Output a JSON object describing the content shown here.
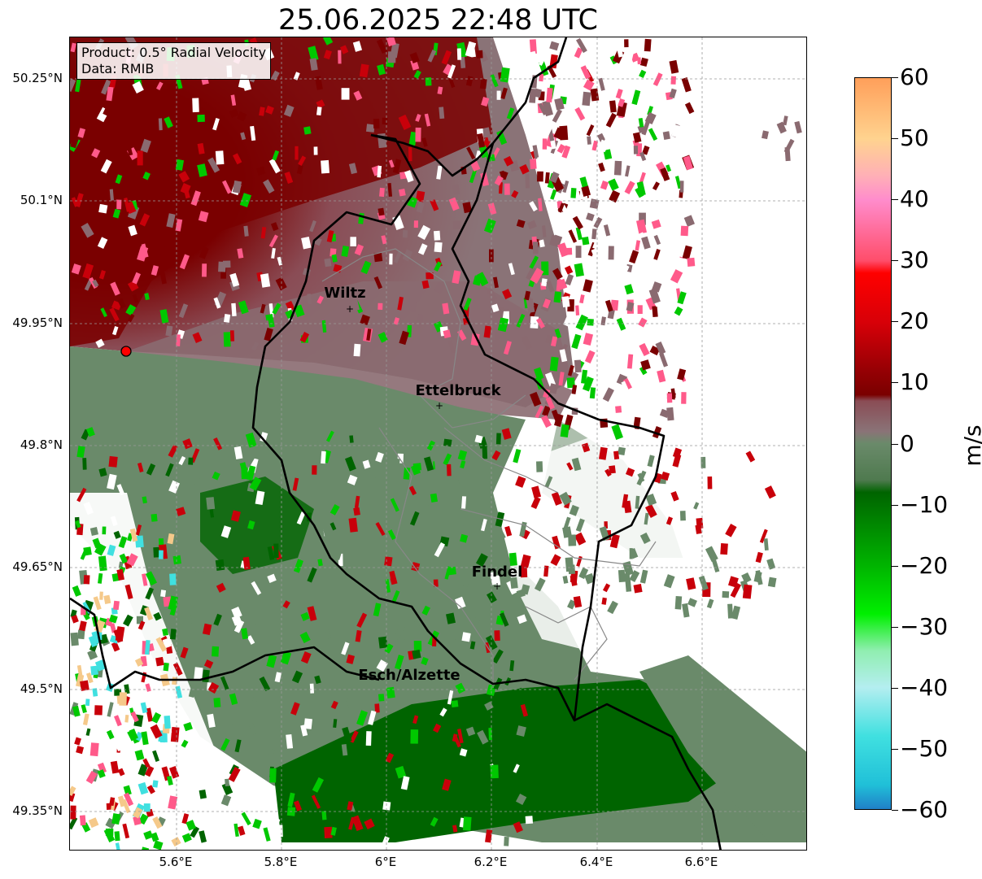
{
  "title": "25.06.2025 22:48 UTC",
  "info_box": {
    "line1": "Product: 0.5° Radial Velocity",
    "line2": "Data: RMIB"
  },
  "latitude_labels": [
    "50.25°N",
    "50.1°N",
    "49.95°N",
    "49.8°N",
    "49.65°N",
    "49.5°N",
    "49.35°N"
  ],
  "longitude_labels": [
    "5.6°E",
    "5.8°E",
    "6°E",
    "6.2°E",
    "6.4°E",
    "6.6°E"
  ],
  "cities": [
    {
      "name": "Wiltz"
    },
    {
      "name": "Ettelbruck"
    },
    {
      "name": "Findel"
    },
    {
      "name": "Esch/Alzette"
    }
  ],
  "colorbar": {
    "unit": "m/s",
    "min": -60,
    "max": 60,
    "ticks": [
      "60",
      "50",
      "40",
      "30",
      "20",
      "10",
      "0",
      "−10",
      "−20",
      "−30",
      "−40",
      "−50",
      "−60"
    ],
    "gradient": [
      {
        "v": 60,
        "color": "#ff9f5a"
      },
      {
        "v": 50,
        "color": "#ffd38f"
      },
      {
        "v": 44,
        "color": "#ffb0b6"
      },
      {
        "v": 40,
        "color": "#ff8ccc"
      },
      {
        "v": 30,
        "color": "#ff4d6a"
      },
      {
        "v": 28,
        "color": "#ff0000"
      },
      {
        "v": 20,
        "color": "#d80008"
      },
      {
        "v": 12,
        "color": "#960004"
      },
      {
        "v": 8,
        "color": "#7a0000"
      },
      {
        "v": 7,
        "color": "#8a4c55"
      },
      {
        "v": 2,
        "color": "#8a7377"
      },
      {
        "v": 0,
        "color": "#6a8a6a"
      },
      {
        "v": -6,
        "color": "#4f7a4f"
      },
      {
        "v": -8,
        "color": "#006400"
      },
      {
        "v": -20,
        "color": "#00b400"
      },
      {
        "v": -28,
        "color": "#00f000"
      },
      {
        "v": -34,
        "color": "#90eeb0"
      },
      {
        "v": -40,
        "color": "#b4eef0"
      },
      {
        "v": -48,
        "color": "#40e0e0"
      },
      {
        "v": -56,
        "color": "#20c0d8"
      },
      {
        "v": -60,
        "color": "#2080c8"
      }
    ]
  },
  "radar_colors": {
    "dark_red": "#7a0000",
    "red": "#c8000a",
    "mauve": "#8a6a70",
    "grey_green": "#6a8a6a",
    "dark_green": "#006400",
    "green": "#00c800",
    "pink": "#ff5a8a",
    "cyan": "#40e0e0",
    "radar_site": "#ff0000"
  }
}
